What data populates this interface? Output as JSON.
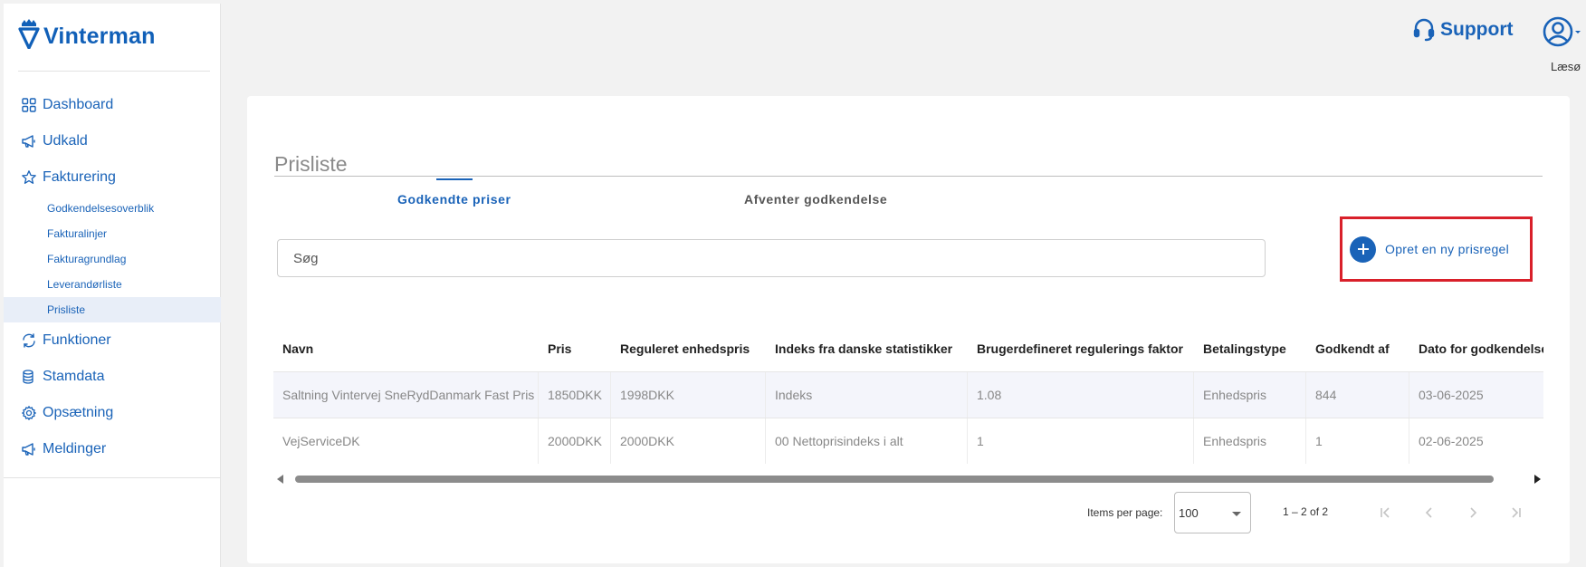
{
  "app": {
    "brand": "Vinterman"
  },
  "sidebar": {
    "items": [
      {
        "label": "Dashboard"
      },
      {
        "label": "Udkald"
      },
      {
        "label": "Fakturering"
      },
      {
        "label": "Funktioner"
      },
      {
        "label": "Stamdata"
      },
      {
        "label": "Opsætning"
      },
      {
        "label": "Meldinger"
      }
    ],
    "subitems": [
      {
        "label": "Godkendelsesoverblik"
      },
      {
        "label": "Fakturalinjer"
      },
      {
        "label": "Fakturagrundlag"
      },
      {
        "label": "Leverandørliste"
      },
      {
        "label": "Prisliste",
        "active": true
      }
    ]
  },
  "header": {
    "support_label": "Support",
    "user_label": "Læsø"
  },
  "main": {
    "title": "Prisliste",
    "tabs": [
      {
        "label": "Godkendte priser",
        "active": true
      },
      {
        "label": "Afventer godkendelse"
      }
    ],
    "search": {
      "placeholder": "Søg",
      "value": ""
    },
    "create_button": "Opret en ny prisregel",
    "table": {
      "columns": [
        "Navn",
        "Pris",
        "Reguleret enhedspris",
        "Indeks fra danske statistikker",
        "Brugerdefineret regulerings faktor",
        "Betalingstype",
        "Godkendt af",
        "Dato for godkendelse"
      ],
      "rows": [
        [
          "Saltning Vintervej SneRydDanmark Fast Pris",
          "1850DKK",
          "1998DKK",
          "Indeks",
          "1.08",
          "Enhedspris",
          "844",
          "03-06-2025"
        ],
        [
          "VejServiceDK",
          "2000DKK",
          "2000DKK",
          "00 Nettoprisindeks i alt",
          "1",
          "Enhedspris",
          "1",
          "02-06-2025"
        ]
      ]
    },
    "paginator": {
      "items_per_page_label": "Items per page:",
      "items_per_page": "100",
      "range": "1 – 2 of 2"
    }
  },
  "colors": {
    "accent": "#1a63b8",
    "highlight_border": "#d9202a"
  }
}
